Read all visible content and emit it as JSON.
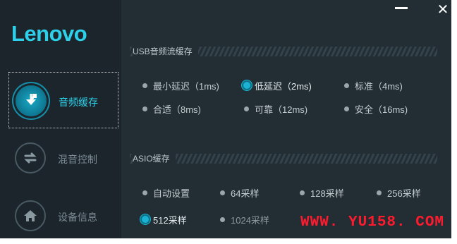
{
  "app": {
    "brand": "Lenovo"
  },
  "window_controls": {
    "close_glyph": "✕"
  },
  "sidebar": {
    "items": [
      {
        "label": "音频缓存",
        "icon": "music-download-icon",
        "active": true
      },
      {
        "label": "混音控制",
        "icon": "swap-arrows-icon",
        "active": false
      },
      {
        "label": "设备信息",
        "icon": "home-icon",
        "active": false
      }
    ]
  },
  "usb_buffer": {
    "title": "USB音频流缓存",
    "options": [
      {
        "label": "最小延迟（1ms)",
        "selected": false
      },
      {
        "label": "低延迟（2ms)",
        "selected": true
      },
      {
        "label": "标准（4ms)",
        "selected": false
      },
      {
        "label": "合适（8ms)",
        "selected": false
      },
      {
        "label": "可靠（12ms)",
        "selected": false
      },
      {
        "label": "安全（16ms)",
        "selected": false
      }
    ]
  },
  "asio_buffer": {
    "title": "ASIO缓存",
    "options": [
      {
        "label": "自动设置",
        "selected": false
      },
      {
        "label": "64采样",
        "selected": false
      },
      {
        "label": "128采样",
        "selected": false
      },
      {
        "label": "256采样",
        "selected": false
      },
      {
        "label": "512采样",
        "selected": true
      },
      {
        "label": "1024采样",
        "selected": false
      }
    ]
  },
  "watermark": "WWW. YU158. COM",
  "colors": {
    "accent": "#2ed0e9",
    "background": "#222d34",
    "sidebar": "#1b252b",
    "watermark": "#ff1b2d"
  }
}
